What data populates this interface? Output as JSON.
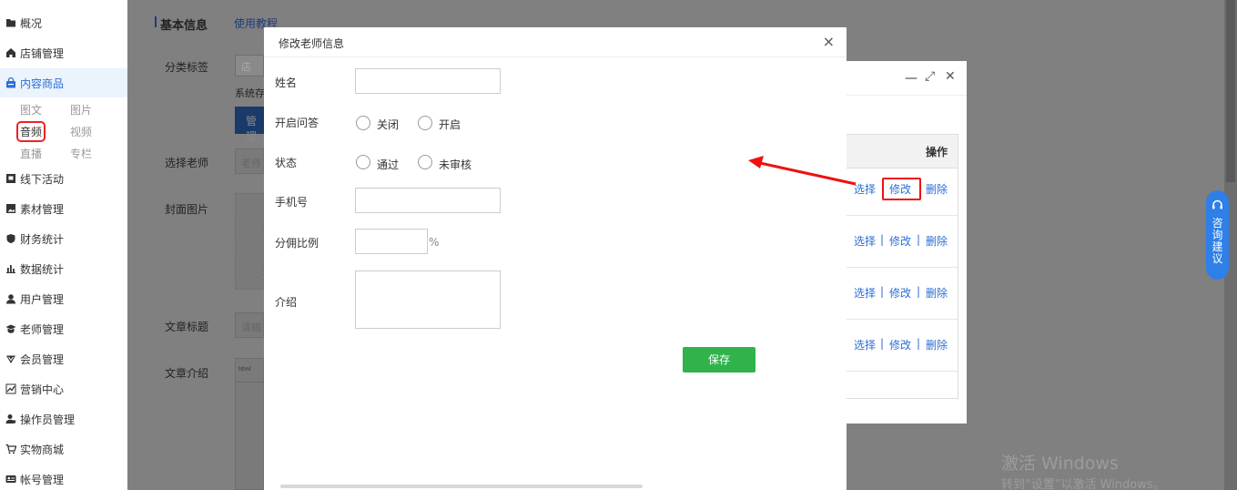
{
  "sidebar": {
    "items": [
      {
        "label": "概况",
        "icon": "folder-icon"
      },
      {
        "label": "店铺管理",
        "icon": "home-icon"
      },
      {
        "label": "内容商品",
        "icon": "bag-icon"
      },
      {
        "label": "线下活动",
        "icon": "flag-icon"
      },
      {
        "label": "素材管理",
        "icon": "image-icon"
      },
      {
        "label": "财务统计",
        "icon": "shield-icon"
      },
      {
        "label": "数据统计",
        "icon": "chart-icon"
      },
      {
        "label": "用户管理",
        "icon": "user-icon"
      },
      {
        "label": "老师管理",
        "icon": "teacher-icon"
      },
      {
        "label": "会员管理",
        "icon": "vip-icon"
      },
      {
        "label": "营销中心",
        "icon": "trend-icon"
      },
      {
        "label": "操作员管理",
        "icon": "operator-icon"
      },
      {
        "label": "实物商城",
        "icon": "cart-icon"
      },
      {
        "label": "帐号管理",
        "icon": "id-card-icon"
      }
    ],
    "sub_items": [
      "图文",
      "图片",
      "音频",
      "视频",
      "直播",
      "专栏"
    ],
    "active_color": "#2b6fd6"
  },
  "background": {
    "section_title": "基本信息",
    "tutorial_link": "使用教程",
    "category_label": "分类标签",
    "system_text": "系统存",
    "manage_btn": "管理",
    "tag_text": "店",
    "select_teacher_label": "选择老师",
    "teacher_placeholder": "老师",
    "cover_label": "封面图片",
    "article_title_label": "文章标题",
    "article_title_placeholder": "请输",
    "article_intro_label": "文章介绍",
    "editor_tag": "html"
  },
  "teacher_window": {
    "minimize": "—",
    "maximize": "⤢",
    "close": "✕",
    "column_header": "操作",
    "rows": [
      {
        "select": "选择",
        "edit": "修改",
        "delete": "删除"
      },
      {
        "select": "选择",
        "edit": "修改",
        "delete": "删除"
      },
      {
        "select": "选择",
        "edit": "修改",
        "delete": "删除"
      },
      {
        "select": "选择",
        "edit": "修改",
        "delete": "删除"
      }
    ],
    "separator": "|"
  },
  "modal": {
    "title": "修改老师信息",
    "close": "×",
    "name_label": "姓名",
    "name_value": "",
    "qa_label": "开启问答",
    "qa_options": [
      "关闭",
      "开启"
    ],
    "status_label": "状态",
    "status_options": [
      "通过",
      "未审核"
    ],
    "phone_label": "手机号",
    "phone_value": "",
    "commission_label": "分佣比例",
    "commission_value": "",
    "commission_unit": "%",
    "intro_label": "介绍",
    "intro_value": "",
    "save_label": "保存",
    "save_color": "#2fb34a"
  },
  "consult": {
    "label": "咨询建议",
    "color": "#2f7fe8"
  },
  "watermark": {
    "line1": "激活 Windows",
    "line2": "转到“设置”以激活 Windows。"
  },
  "annotation_color": "#e11"
}
